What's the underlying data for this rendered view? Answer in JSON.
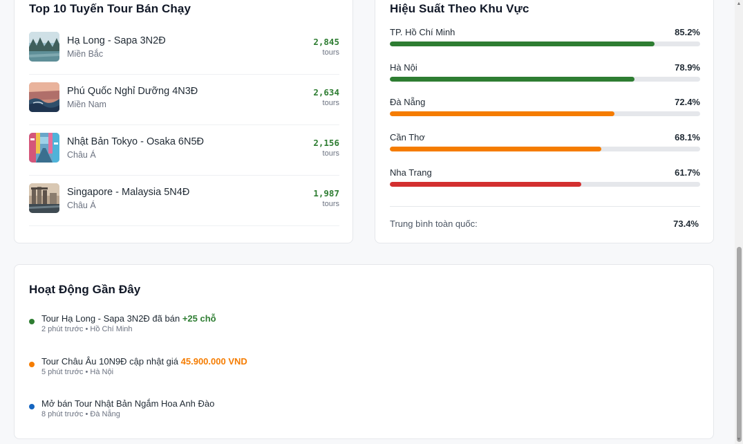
{
  "top_tours": {
    "title": "Top 10 Tuyến Tour Bán Chạy",
    "items": [
      {
        "name": "Hạ Long - Sapa 3N2Đ",
        "region": "Miền Bắc",
        "count": "2,845",
        "unit": "tours",
        "thumb": "halong-bay-photo"
      },
      {
        "name": "Phú Quốc Nghỉ Dưỡng 4N3Đ",
        "region": "Miền Nam",
        "count": "2,634",
        "unit": "tours",
        "thumb": "sunset-wave-photo"
      },
      {
        "name": "Nhật Bản Tokyo - Osaka 6N5Đ",
        "region": "Châu Á",
        "count": "2,156",
        "unit": "tours",
        "thumb": "tokyo-street-photo"
      },
      {
        "name": "Singapore - Malaysia 5N4Đ",
        "region": "Châu Á",
        "count": "1,987",
        "unit": "tours",
        "thumb": "singapore-skyline-photo"
      }
    ]
  },
  "region_performance": {
    "title": "Hiệu Suất Theo Khu Vực",
    "rows": [
      {
        "name": "TP. Hồ Chí Minh",
        "pct_label": "85.2%",
        "value": 85.2,
        "color": "#2e7d32"
      },
      {
        "name": "Hà Nội",
        "pct_label": "78.9%",
        "value": 78.9,
        "color": "#2e7d32"
      },
      {
        "name": "Đà Nẵng",
        "pct_label": "72.4%",
        "value": 72.4,
        "color": "#f57c00"
      },
      {
        "name": "Cần Thơ",
        "pct_label": "68.1%",
        "value": 68.1,
        "color": "#f57c00"
      },
      {
        "name": "Nha Trang",
        "pct_label": "61.7%",
        "value": 61.7,
        "color": "#d32f2f"
      }
    ],
    "avg_label": "Trung bình toàn quốc:",
    "avg_value": "73.4%"
  },
  "activity": {
    "title": "Hoạt Động Gần Đây",
    "items": [
      {
        "prefix": "Tour Hạ Long - Sapa 3N2Đ đã bán ",
        "highlight": "+25 chỗ",
        "highlight_color": "#2e7d32",
        "dot_color": "#2e7d32",
        "meta": "2 phút trước • Hồ Chí Minh"
      },
      {
        "prefix": "Tour Châu Âu 10N9Đ cập nhật giá ",
        "highlight": "45.900.000 VND",
        "highlight_color": "#f57c00",
        "dot_color": "#f57c00",
        "meta": "5 phút trước • Hà Nội"
      },
      {
        "prefix": "Mở bán Tour Nhật Bản Ngắm Hoa Anh Đào",
        "highlight": "",
        "highlight_color": "#1f2933",
        "dot_color": "#1565c0",
        "meta": "8 phút trước • Đà Nẵng"
      }
    ]
  },
  "colors": {
    "success": "#2e7d32",
    "warning": "#f57c00",
    "danger": "#d32f2f",
    "info": "#1565c0"
  }
}
